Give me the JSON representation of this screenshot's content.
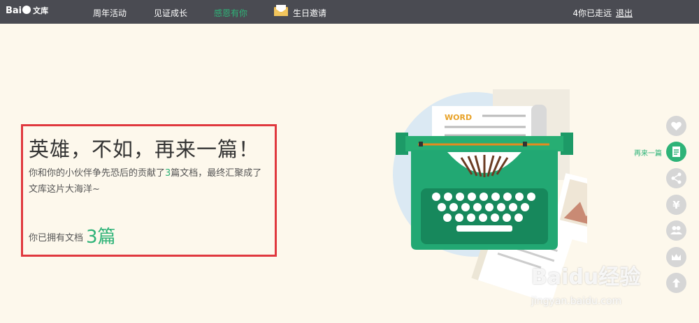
{
  "header": {
    "logo_text": "Bai",
    "logo_suffix": "文库",
    "nav": [
      {
        "label": "周年活动"
      },
      {
        "label": "见证成长"
      },
      {
        "label": "感恩有你",
        "active": true
      },
      {
        "label": "生日邀请"
      }
    ],
    "user_status": "4你已走远",
    "logout_label": "退出"
  },
  "hero": {
    "title": "英雄，不如，再来一篇！",
    "desc_prefix": "你和你的小伙伴争先恐后的贡献了",
    "desc_count": "3",
    "desc_suffix": "篇文档，最终汇聚成了文库这片大海洋~",
    "owned_label": "你已拥有文档",
    "owned_count": "3篇"
  },
  "illustration": {
    "paper_label": "WORD"
  },
  "toolbar": {
    "active_label": "再来一篇",
    "items": [
      "heart-icon",
      "document-icon",
      "share-icon",
      "yen-icon",
      "users-icon",
      "crown-icon",
      "arrow-up-icon"
    ]
  },
  "watermark": {
    "brand": "Baidu经验",
    "url": "jingyan.baidu.com"
  },
  "colors": {
    "topbar": "#4a4b52",
    "accent": "#2eb378",
    "highlight_border": "#e0383e",
    "page_bg": "#fdf8ec"
  }
}
